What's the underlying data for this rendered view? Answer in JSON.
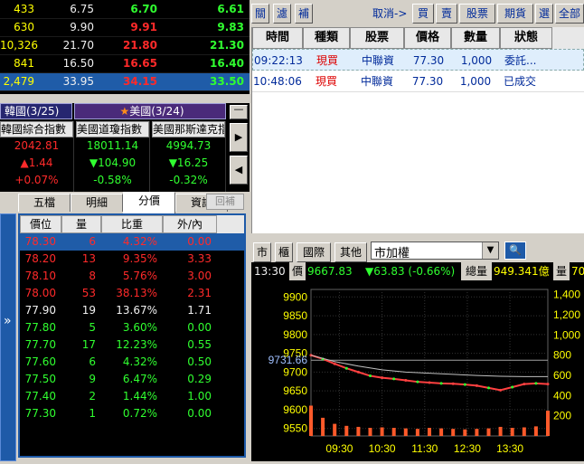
{
  "quote_table": {
    "rows": [
      {
        "vol": "433",
        "ref": "6.75",
        "bid": "6.70",
        "ask": "6.61",
        "bid_color": "g",
        "ask_color": "g"
      },
      {
        "vol": "630",
        "ref": "9.90",
        "bid": "9.91",
        "ask": "9.83",
        "bid_color": "r",
        "ask_color": "g"
      },
      {
        "vol": "10,326",
        "ref": "21.70",
        "bid": "21.80",
        "ask": "21.30",
        "bid_color": "r",
        "ask_color": "g"
      },
      {
        "vol": "841",
        "ref": "16.50",
        "bid": "16.65",
        "ask": "16.40",
        "bid_color": "r",
        "ask_color": "g"
      },
      {
        "vol": "2,479",
        "ref": "33.95",
        "bid": "34.15",
        "ask": "33.50",
        "bid_color": "r",
        "ask_color": "g"
      }
    ]
  },
  "markets": {
    "tab_korea": "韓國(3/25)",
    "tab_us_star": "★",
    "tab_us": "美國(3/24)",
    "indices": [
      {
        "name": "韓國綜合指數",
        "value": "2042.81",
        "change": "▲1.44",
        "pct": "+0.07%",
        "color": "r"
      },
      {
        "name": "美國道瓊指數",
        "value": "18011.14",
        "change": "▼104.90",
        "pct": "-0.58%",
        "color": "g"
      },
      {
        "name": "美國那斯達克指數",
        "value": "4994.73",
        "change": "▼16.25",
        "pct": "-0.32%",
        "color": "g"
      }
    ]
  },
  "tabs": {
    "items": [
      "五檔",
      "明細",
      "分價",
      "資訊"
    ],
    "extra": "回補"
  },
  "depth": {
    "headers": [
      "價位",
      "量",
      "比重",
      "外/內"
    ],
    "rows": [
      {
        "price": "78.30",
        "qty": "6",
        "pct": "4.32%",
        "ratio": "0.00",
        "color": "r",
        "sel": true
      },
      {
        "price": "78.20",
        "qty": "13",
        "pct": "9.35%",
        "ratio": "3.33",
        "color": "r"
      },
      {
        "price": "78.10",
        "qty": "8",
        "pct": "5.76%",
        "ratio": "3.00",
        "color": "r"
      },
      {
        "price": "78.00",
        "qty": "53",
        "pct": "38.13%",
        "ratio": "2.31",
        "color": "r"
      },
      {
        "price": "77.90",
        "qty": "19",
        "pct": "13.67%",
        "ratio": "1.71",
        "color": "w"
      },
      {
        "price": "77.80",
        "qty": "5",
        "pct": "3.60%",
        "ratio": "0.00",
        "color": "g"
      },
      {
        "price": "77.70",
        "qty": "17",
        "pct": "12.23%",
        "ratio": "0.55",
        "color": "g"
      },
      {
        "price": "77.60",
        "qty": "6",
        "pct": "4.32%",
        "ratio": "0.50",
        "color": "g"
      },
      {
        "price": "77.50",
        "qty": "9",
        "pct": "6.47%",
        "ratio": "0.29",
        "color": "g"
      },
      {
        "price": "77.40",
        "qty": "2",
        "pct": "1.44%",
        "ratio": "1.00",
        "color": "g"
      },
      {
        "price": "77.30",
        "qty": "1",
        "pct": "0.72%",
        "ratio": "0.00",
        "color": "g"
      }
    ]
  },
  "toolbar": {
    "b1": "關",
    "b2": "濾",
    "b3": "補",
    "cancel": "取消->",
    "buy": "買",
    "sell": "賣",
    "stock": "股票",
    "futures": "期貨",
    "select": "選",
    "all": "全部"
  },
  "orders": {
    "headers": [
      "時間",
      "種類",
      "股票",
      "價格",
      "數量",
      "狀態"
    ],
    "rows": [
      {
        "time": "09:22:13",
        "kind": "現買",
        "stock": "中聯資",
        "price": "77.30",
        "qty": "1,000",
        "status": "委託..."
      },
      {
        "time": "10:48:06",
        "kind": "現買",
        "stock": "中聯資",
        "price": "77.30",
        "qty": "1,000",
        "status": "已成交"
      }
    ]
  },
  "chart_toolbar": {
    "b1": "市",
    "b2": "櫃",
    "b3": "國際",
    "b4": "其他",
    "select": "市加權"
  },
  "chart_status": {
    "time": "13:30",
    "price_label": "價",
    "price": "9667.83",
    "change": "▼63.83 (-0.66%)",
    "vol_label": "總量",
    "vol": "949.341億",
    "qty_label": "量",
    "qty": "70"
  },
  "chart_data": {
    "type": "line",
    "x_ticks": [
      "09:30",
      "10:30",
      "11:30",
      "12:30",
      "13:30"
    ],
    "y_ticks": [
      9550,
      9600,
      9650,
      9700,
      9750,
      9800,
      9850,
      9900
    ],
    "y2_ticks": [
      "200",
      "400",
      "600",
      "800",
      "1,000",
      "1,200",
      "1,400"
    ],
    "ref_label": "9731.66",
    "ref_value": 9731.66,
    "ylim": [
      9530,
      9920
    ],
    "y2lim": [
      0,
      1450
    ],
    "series": [
      {
        "x": [
          0,
          0.05,
          0.1,
          0.15,
          0.2,
          0.25,
          0.3,
          0.35,
          0.4,
          0.45,
          0.5,
          0.55,
          0.6,
          0.65,
          0.7,
          0.75,
          0.8,
          0.85,
          0.9,
          0.95,
          1.0
        ],
        "values": [
          9745,
          9735,
          9722,
          9710,
          9700,
          9690,
          9685,
          9682,
          9678,
          9674,
          9672,
          9670,
          9669,
          9667,
          9664,
          9658,
          9652,
          9660,
          9668,
          9670,
          9668
        ]
      },
      {
        "x": [
          0,
          0.1,
          0.2,
          0.3,
          0.4,
          0.5,
          0.6,
          0.7,
          0.8,
          0.9,
          1.0
        ],
        "values": [
          9745,
          9728,
          9716,
          9706,
          9700,
          9697,
          9694,
          9691,
          9689,
          9688,
          9688
        ]
      }
    ],
    "volume": [
      300,
      180,
      120,
      100,
      90,
      80,
      85,
      80,
      75,
      70,
      80,
      75,
      70,
      65,
      70,
      75,
      90,
      80,
      85,
      95,
      250
    ]
  }
}
